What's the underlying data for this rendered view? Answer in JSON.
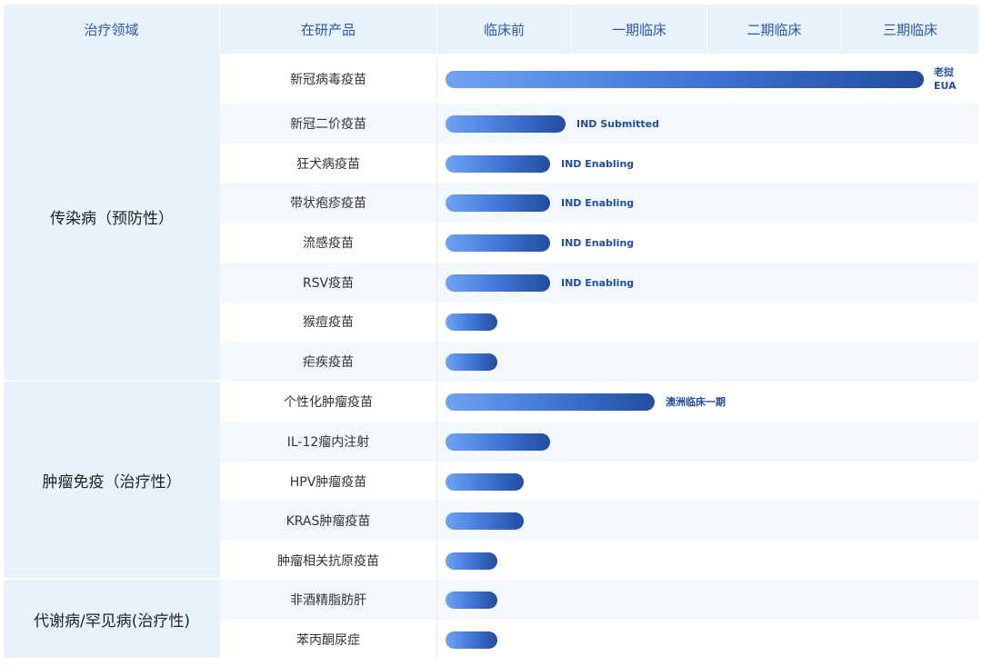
{
  "header": {
    "area": "治疗领域",
    "product": "在研产品",
    "phases": [
      "临床前",
      "一期临床",
      "二期临床",
      "三期临床"
    ]
  },
  "areas": [
    {
      "label": "传染病（预防性）"
    },
    {
      "label": "肿瘤免疫（治疗性）"
    },
    {
      "label": "代谢病/罕见病(治疗性)"
    }
  ],
  "products": [
    {
      "name": "新冠病毒疫苗",
      "progress_pct": 90,
      "status_line1": "老挝",
      "status_line2": "EUA"
    },
    {
      "name": "新冠二价疫苗",
      "progress_pct": 22,
      "status": "IND Submitted"
    },
    {
      "name": "狂犬病疫苗",
      "progress_pct": 20,
      "status": "IND Enabling"
    },
    {
      "name": "带状疱疹疫苗",
      "progress_pct": 20,
      "status": "IND Enabling"
    },
    {
      "name": "流感疫苗",
      "progress_pct": 20,
      "status": "IND Enabling"
    },
    {
      "name": "RSV疫苗",
      "progress_pct": 20,
      "status": "IND Enabling"
    },
    {
      "name": "猴痘疫苗",
      "progress_pct": 10,
      "status": ""
    },
    {
      "name": "疟疾疫苗",
      "progress_pct": 10,
      "status": ""
    },
    {
      "name": "个性化肿瘤疫苗",
      "progress_pct": 40,
      "status": "澳洲临床一期"
    },
    {
      "name": "IL-12瘤内注射",
      "progress_pct": 20,
      "status": ""
    },
    {
      "name": "HPV肿瘤疫苗",
      "progress_pct": 15,
      "status": ""
    },
    {
      "name": "KRAS肿瘤疫苗",
      "progress_pct": 15,
      "status": ""
    },
    {
      "name": "肿瘤相关抗原疫苗",
      "progress_pct": 10,
      "status": ""
    },
    {
      "name": "非酒精脂肪肝",
      "progress_pct": 10,
      "status": ""
    },
    {
      "name": "苯丙酮尿症",
      "progress_pct": 10,
      "status": ""
    }
  ],
  "colors": {
    "header_bg": "#e8f2fc",
    "header_text": "#2b57a8",
    "bar_start": "#6fa3f4",
    "bar_end": "#234d9e",
    "status_text": "#234d9e"
  }
}
